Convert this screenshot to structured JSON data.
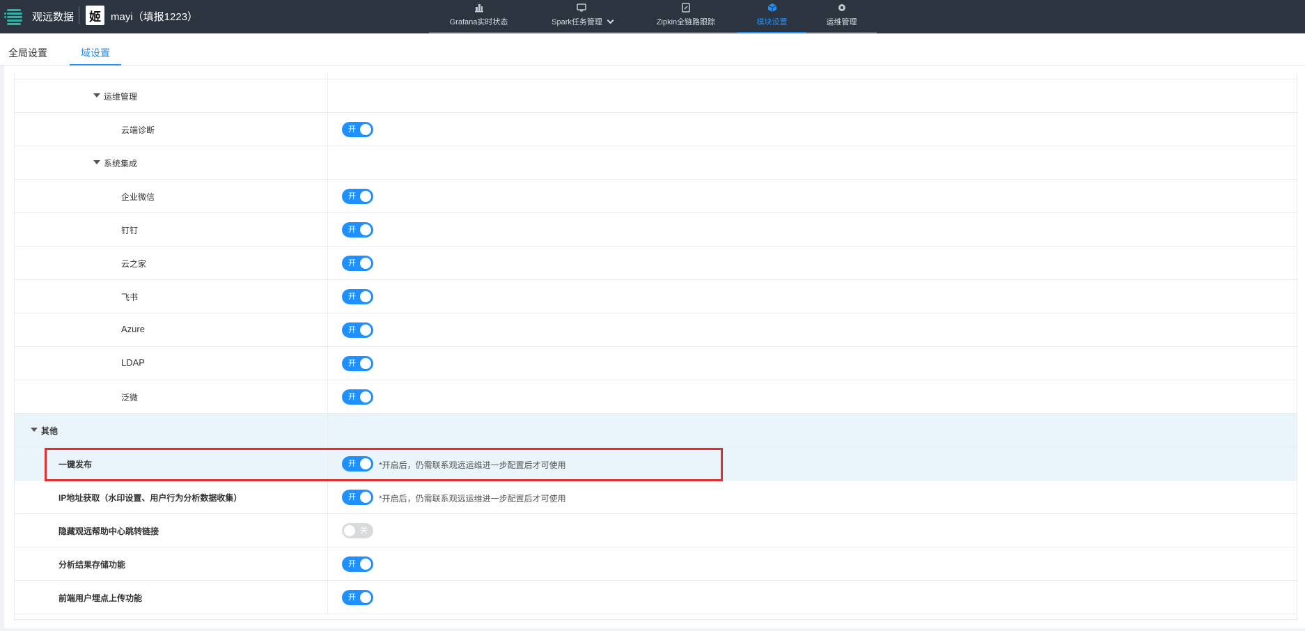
{
  "header": {
    "brand": "观远数据",
    "logo_text": "姬",
    "project": "mayi（填报1223）",
    "nav": [
      {
        "label": "Grafana实时状态",
        "icon": "dashboard-icon",
        "active": false
      },
      {
        "label": "Spark任务管理",
        "icon": "monitor-icon",
        "active": false,
        "dropdown": true
      },
      {
        "label": "Zipkin全链路跟踪",
        "icon": "document-edit-icon",
        "active": false
      },
      {
        "label": "模块设置",
        "icon": "cube-icon",
        "active": true
      },
      {
        "label": "运维管理",
        "icon": "gear-icon",
        "active": false
      }
    ]
  },
  "tabs": [
    {
      "label": "全局设置",
      "active": false
    },
    {
      "label": "域设置",
      "active": true
    }
  ],
  "rows": [
    {
      "label": "运维管理",
      "type": "group"
    },
    {
      "label": "云端诊断",
      "switch": "on",
      "switch_text": "开"
    },
    {
      "label": "系统集成",
      "type": "group"
    },
    {
      "label": "企业微信",
      "switch": "on",
      "switch_text": "开"
    },
    {
      "label": "钉钉",
      "switch": "on",
      "switch_text": "开"
    },
    {
      "label": "云之家",
      "switch": "on",
      "switch_text": "开"
    },
    {
      "label": "飞书",
      "switch": "on",
      "switch_text": "开"
    },
    {
      "label": "Azure",
      "switch": "on",
      "switch_text": "开"
    },
    {
      "label": "LDAP",
      "switch": "on",
      "switch_text": "开"
    },
    {
      "label": "泛微",
      "switch": "on",
      "switch_text": "开"
    },
    {
      "label": "其他",
      "type": "group"
    },
    {
      "label": "一键发布",
      "switch": "on",
      "switch_text": "开",
      "hint": "*开启后，仍需联系观远运维进一步配置后才可使用"
    },
    {
      "label": "IP地址获取（水印设置、用户行为分析数据收集）",
      "switch": "on",
      "switch_text": "开",
      "hint": "*开启后，仍需联系观远运维进一步配置后才可使用"
    },
    {
      "label": "隐藏观远帮助中心跳转链接",
      "switch": "off",
      "switch_text": "关"
    },
    {
      "label": "分析结果存储功能",
      "switch": "on",
      "switch_text": "开"
    },
    {
      "label": "前端用户埋点上传功能",
      "switch": "on",
      "switch_text": "开"
    }
  ],
  "colors": {
    "topbar": "#2c3440",
    "accent": "#1e90ff",
    "highlight_row": "#e9f4fb",
    "annotation_box": "#e02f2f"
  }
}
